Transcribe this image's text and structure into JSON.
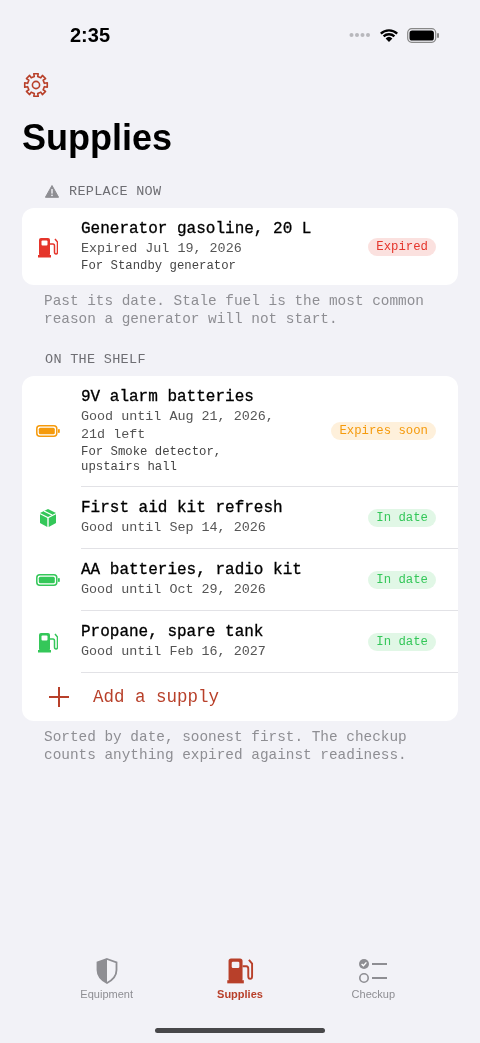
{
  "status_bar": {
    "time": "2:35"
  },
  "title": "Supplies",
  "sections": [
    {
      "header": "REPLACE NOW",
      "warning": true,
      "items": [
        {
          "kind": "fuel",
          "color": "#e5352b",
          "name": "Generator gasoline, 20 L",
          "date": "Expired Jul 19, 2026",
          "for": "For Standby generator",
          "badge": "Expired"
        }
      ],
      "footer": "Past its date. Stale fuel is the most common reason a generator will not start."
    },
    {
      "header": "ON THE SHELF",
      "warning": false,
      "items": [
        {
          "kind": "battery",
          "color": "#f59a0c",
          "name": "9V alarm batteries",
          "date": "Good until Aug 21, 2026, 21d left",
          "for": "For Smoke detector, upstairs hall",
          "badge": "Expires soon"
        },
        {
          "kind": "box",
          "color": "#34c759",
          "name": "First aid kit refresh",
          "date": "Good until Sep 14, 2026",
          "badge": "In date"
        },
        {
          "kind": "battery",
          "color": "#34c759",
          "name": "AA batteries, radio kit",
          "date": "Good until Oct 29, 2026",
          "badge": "In date"
        },
        {
          "kind": "fuel",
          "color": "#34c759",
          "name": "Propane, spare tank",
          "date": "Good until Feb 16, 2027",
          "badge": "In date"
        }
      ],
      "add_label": "Add a supply",
      "footer": "Sorted by date, soonest first. The checkup counts anything expired against readiness."
    }
  ],
  "tabs": [
    {
      "kind": "shield",
      "label": "Equipment",
      "selected": false
    },
    {
      "kind": "fuel",
      "label": "Supplies",
      "selected": true
    },
    {
      "kind": "checklist",
      "label": "Checkup",
      "selected": false
    }
  ]
}
